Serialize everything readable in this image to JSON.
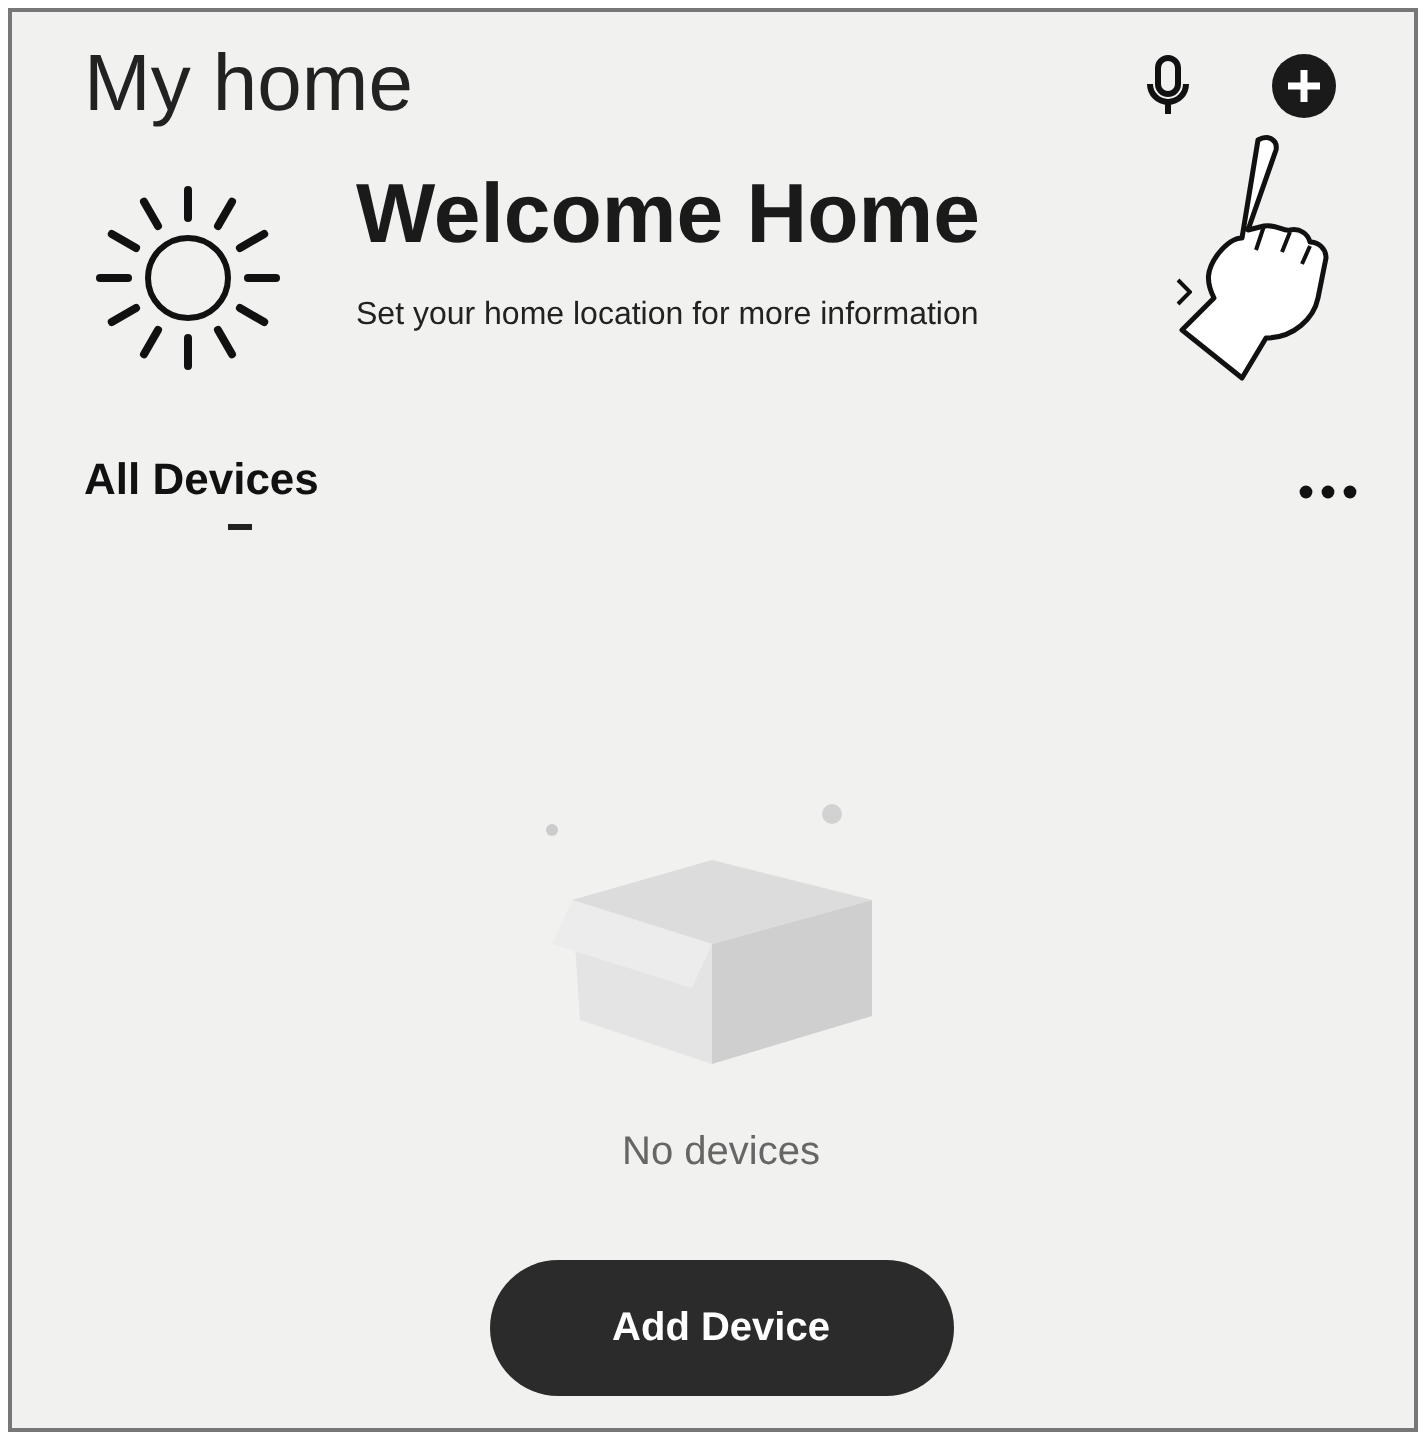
{
  "header": {
    "title": "My home"
  },
  "welcome": {
    "title": "Welcome Home",
    "subtitle": "Set your home location for more information"
  },
  "tabs": [
    {
      "label": "All Devices",
      "selected": true
    }
  ],
  "empty_state": {
    "message": "No devices",
    "button": "Add Device"
  }
}
